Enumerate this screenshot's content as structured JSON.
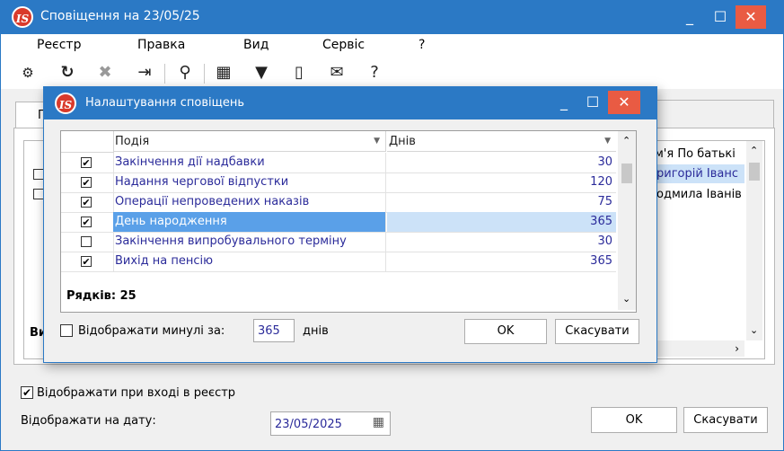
{
  "main_window": {
    "title": "Сповіщення на 23/05/25",
    "controls": {
      "minimize": "_",
      "maximize": "☐",
      "close": "✕"
    },
    "logo_text": "IS",
    "menu": [
      "Реєстр",
      "Правка",
      "Вид",
      "Сервіс",
      "?"
    ],
    "tab_partial": "Г",
    "background_columns": {
      "header_partial": "м'я По батькі"
    },
    "background_rows": [
      "ригорій Іванс",
      "одмила Іванів"
    ],
    "footer_partial": "Ви",
    "show_on_entry": {
      "label": "Відображати при вході в реєстр",
      "checked": true
    },
    "show_date": {
      "label": "Відображати на дату:",
      "value": "23/05/2025"
    },
    "buttons": {
      "ok": "OK",
      "cancel": "Скасувати"
    }
  },
  "dialog": {
    "title": "Налаштування сповіщень",
    "logo_text": "IS",
    "controls": {
      "minimize": "_",
      "maximize": "☐",
      "close": "✕"
    },
    "grid": {
      "columns": {
        "event": "Подія",
        "days": "Днів"
      },
      "rows": [
        {
          "checked": true,
          "event": "Закінчення дії надбавки",
          "days": "30",
          "selected": false
        },
        {
          "checked": true,
          "event": "Надання чергової відпустки",
          "days": "120",
          "selected": false
        },
        {
          "checked": true,
          "event": "Операції непроведених наказів",
          "days": "75",
          "selected": false
        },
        {
          "checked": true,
          "event": "День народження",
          "days": "365",
          "selected": true
        },
        {
          "checked": false,
          "event": "Закінчення випробувального терміну",
          "days": "30",
          "selected": false
        },
        {
          "checked": true,
          "event": "Вихід на пенсію",
          "days": "365",
          "selected": false
        }
      ],
      "row_count_label": "Рядків: 25"
    },
    "show_past": {
      "label": "Відображати минулі за:",
      "value": "365",
      "unit": "днів",
      "checked": false
    },
    "buttons": {
      "ok": "OK",
      "cancel": "Скасувати"
    }
  },
  "colors": {
    "title_bar": "#2b79c5",
    "close_button": "#e95b43",
    "selection": "#5aa0e8",
    "link_text": "#2b2b9a"
  }
}
